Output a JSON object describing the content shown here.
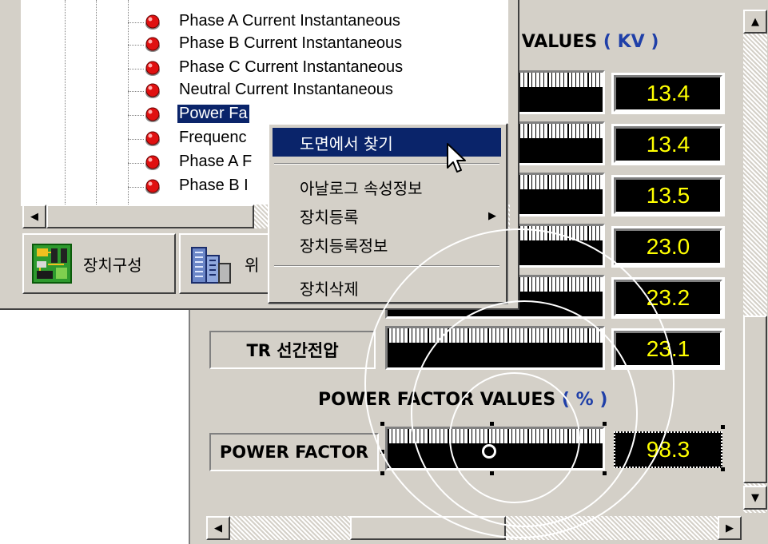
{
  "tree": {
    "items": [
      {
        "label": "Phase A Current Instantaneous",
        "selected": false
      },
      {
        "label": "Phase B Current Instantaneous",
        "selected": false
      },
      {
        "label": "Phase C Current Instantaneous",
        "selected": false
      },
      {
        "label": "Neutral Current Instantaneous",
        "selected": false
      },
      {
        "label": "Power Fa",
        "selected": true
      },
      {
        "label": "Frequenc",
        "selected": false
      },
      {
        "label": "Phase A F",
        "selected": false
      },
      {
        "label": "Phase B I",
        "selected": false
      }
    ],
    "tabs": [
      {
        "label": "장치구성"
      },
      {
        "label": "위"
      }
    ]
  },
  "context_menu": {
    "items": [
      {
        "label": "도면에서 찾기",
        "highlighted": true
      },
      {
        "label": "아날로그 속성정보"
      },
      {
        "label": "장치등록",
        "submenu": true
      },
      {
        "label": "장치등록정보"
      },
      {
        "label": "장치삭제"
      }
    ],
    "submenu_arrow": "▶"
  },
  "panel": {
    "voltage_title": "E VALUES",
    "voltage_unit": "( KV )",
    "voltage_values": [
      "13.4",
      "13.4",
      "13.5",
      "23.0",
      "23.2",
      "23.1"
    ],
    "tr_label": "TR 선간전압",
    "pf_title": "POWER FACTOR VALUES",
    "pf_unit": "( % )",
    "pf_label": "POWER FACTOR",
    "pf_value": "98.3"
  },
  "scrollbars": {
    "up": "▲",
    "down": "▼",
    "left": "◀",
    "right": "▶"
  },
  "colors": {
    "face": "#d4d0c8",
    "highlight": "#0a246a",
    "value_text": "#ffff00",
    "unit_text": "#1f3fa8"
  }
}
